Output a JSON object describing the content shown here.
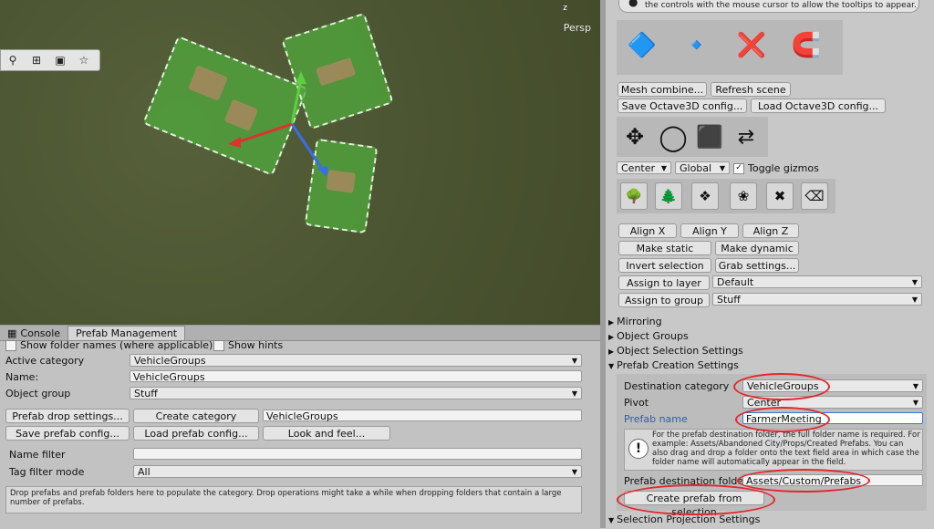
{
  "scene": {
    "view_label": "Persp",
    "axis_label": "z",
    "tools": [
      "magnifier-icon",
      "move-camera-icon",
      "camera-icon",
      "star-icon"
    ]
  },
  "bottom_panel": {
    "tabs": [
      {
        "label": "Console",
        "icon": "console-icon"
      },
      {
        "label": "Prefab Management",
        "icon": ""
      }
    ],
    "show_folder_names_label": "Show folder names (where applicable)",
    "show_hints_label": "Show hints",
    "active_category_label": "Active category",
    "active_category_value": "VehicleGroups",
    "name_label": "Name:",
    "name_value": "VehicleGroups",
    "object_group_label": "Object group",
    "object_group_value": "Stuff",
    "prefab_drop_settings_btn": "Prefab drop settings...",
    "create_category_btn": "Create category",
    "create_category_value": "VehicleGroups",
    "save_prefab_config_btn": "Save prefab config...",
    "load_prefab_config_btn": "Load prefab config...",
    "look_and_feel_btn": "Look and feel...",
    "name_filter_label": "Name filter",
    "name_filter_value": "",
    "tag_filter_label": "Tag filter mode",
    "tag_filter_value": "All",
    "drop_hint": "Drop prefabs and prefab folders here to populate the category. Drop operations might take a while when dropping folders that contain a large number of prefabs."
  },
  "inspector": {
    "top_hint": "the controls with the mouse cursor to allow the tooltips to appear.",
    "mesh_combine_btn": "Mesh combine...",
    "refresh_scene_btn": "Refresh scene",
    "save_octave_btn": "Save Octave3D config...",
    "load_octave_btn": "Load Octave3D config...",
    "pivot_mode": "Center",
    "space_mode": "Global",
    "toggle_gizmos_label": "Toggle gizmos",
    "align_x_btn": "Align X",
    "align_y_btn": "Align Y",
    "align_z_btn": "Align Z",
    "make_static_btn": "Make static",
    "make_dynamic_btn": "Make dynamic",
    "invert_selection_btn": "Invert selection",
    "grab_settings_btn": "Grab settings...",
    "assign_layer_btn": "Assign to layer",
    "assign_layer_value": "Default",
    "assign_group_btn": "Assign to group",
    "assign_group_value": "Stuff",
    "foldouts": [
      "Mirroring",
      "Object Groups",
      "Object Selection Settings",
      "Prefab Creation Settings"
    ],
    "destination_category_label": "Destination category",
    "destination_category_value": "VehicleGroups",
    "pivot_label": "Pivot",
    "pivot_value": "Center",
    "prefab_name_label": "Prefab name",
    "prefab_name_value": "FarmerMeeting",
    "folder_help": "For the prefab destination folder, the full folder name is required. For example: Assets/Abandoned City/Props/Created Prefabs. You can also drag and drop a folder onto the text field area in which case the folder name will automatically appear in the field.",
    "prefab_destination_label": "Prefab destination folder",
    "prefab_destination_value": "Assets/Custom/Prefabs",
    "create_prefab_btn": "Create prefab from selection",
    "selection_projection_label": "Selection Projection Settings"
  }
}
